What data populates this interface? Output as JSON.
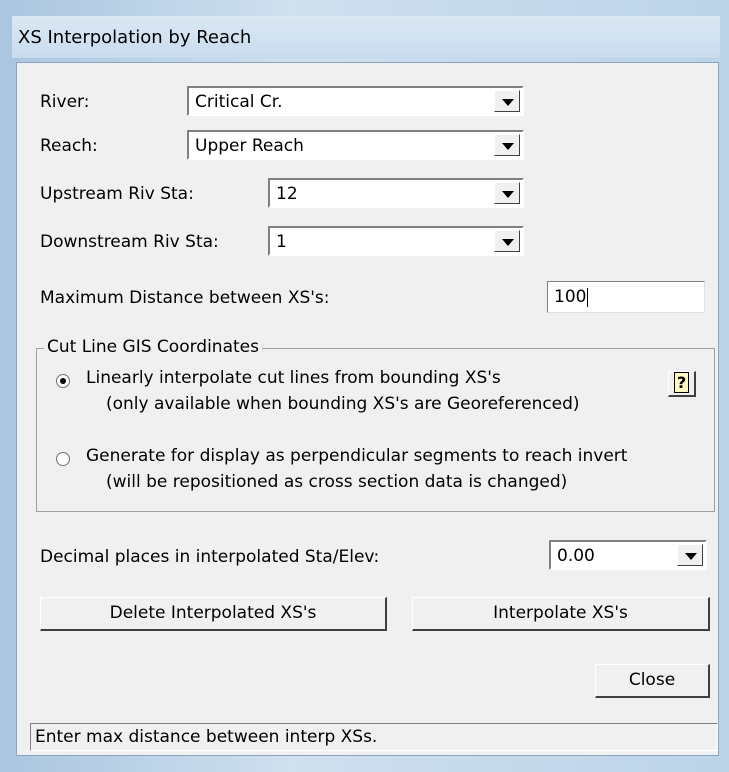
{
  "window": {
    "title": "XS Interpolation by Reach"
  },
  "fields": {
    "river": {
      "label": "River:",
      "value": "Critical Cr."
    },
    "reach": {
      "label": "Reach:",
      "value": "Upper Reach"
    },
    "upstream": {
      "label": "Upstream Riv Sta:",
      "value": "12"
    },
    "downstream": {
      "label": "Downstream Riv Sta:",
      "value": "1"
    },
    "max_distance": {
      "label": "Maximum  Distance  between XS's:",
      "value": "100"
    }
  },
  "cut_line": {
    "group_label": "Cut Line GIS Coordinates",
    "options": [
      {
        "line1": "Linearly interpolate cut lines from bounding XS's",
        "line2": "(only available when bounding XS's are Georeferenced)",
        "selected": true
      },
      {
        "line1": "Generate for display as perpendicular segments to reach invert",
        "line2": "(will be repositioned as cross section data is changed)",
        "selected": false
      }
    ],
    "help_label": "?"
  },
  "decimal": {
    "label": "Decimal places in interpolated Sta/Elev:",
    "value": "0.00"
  },
  "buttons": {
    "delete": "Delete Interpolated  XS's",
    "interpolate": "Interpolate XS's",
    "close": "Close"
  },
  "status": "Enter max distance between interp XSs."
}
